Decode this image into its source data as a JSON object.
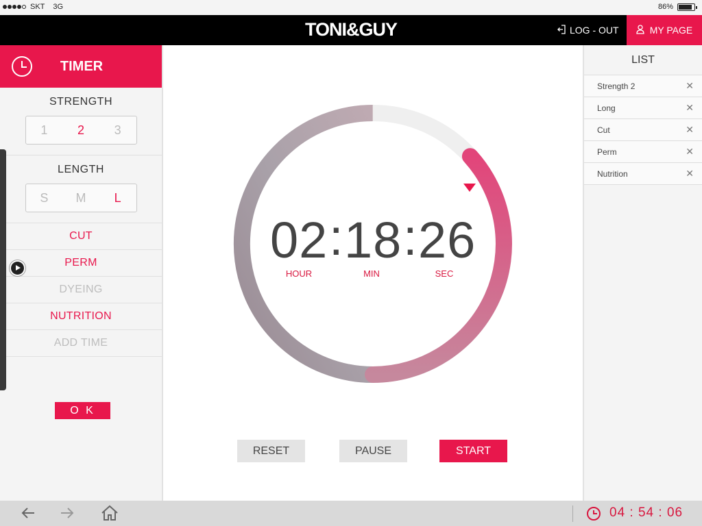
{
  "status_bar": {
    "carrier": "SKT",
    "network": "3G",
    "battery": "86%",
    "battery_level": 0.86
  },
  "header": {
    "logo": "TONI&GUY",
    "logout_label": "LOG - OUT",
    "mypage_label": "MY PAGE"
  },
  "left_panel": {
    "title": "TIMER",
    "strength": {
      "title": "STRENGTH",
      "options": [
        "1",
        "2",
        "3"
      ],
      "selected": "2"
    },
    "length": {
      "title": "LENGTH",
      "options": [
        "S",
        "M",
        "L"
      ],
      "selected": "L"
    },
    "menu": [
      {
        "label": "CUT",
        "active": true
      },
      {
        "label": "PERM",
        "active": true
      },
      {
        "label": "DYEING",
        "active": false
      },
      {
        "label": "NUTRITION",
        "active": true
      },
      {
        "label": "ADD TIME",
        "active": false
      }
    ],
    "ok_label": "O K"
  },
  "timer": {
    "hours": "02",
    "minutes": "18",
    "seconds": "26",
    "sep": ":",
    "hour_label": "HOUR",
    "min_label": "MIN",
    "sec_label": "SEC",
    "progress": 0.87
  },
  "buttons": {
    "reset": "RESET",
    "pause": "PAUSE",
    "start": "START"
  },
  "list": {
    "title": "LIST",
    "items": [
      "Strength 2",
      "Long",
      "Cut",
      "Perm",
      "Nutrition"
    ],
    "close_glyph": "✕"
  },
  "bottom": {
    "clock": "04 : 54 : 06"
  },
  "colors": {
    "accent": "#e8174c",
    "header_bg": "#000000",
    "panel_bg": "#f4f4f4"
  }
}
